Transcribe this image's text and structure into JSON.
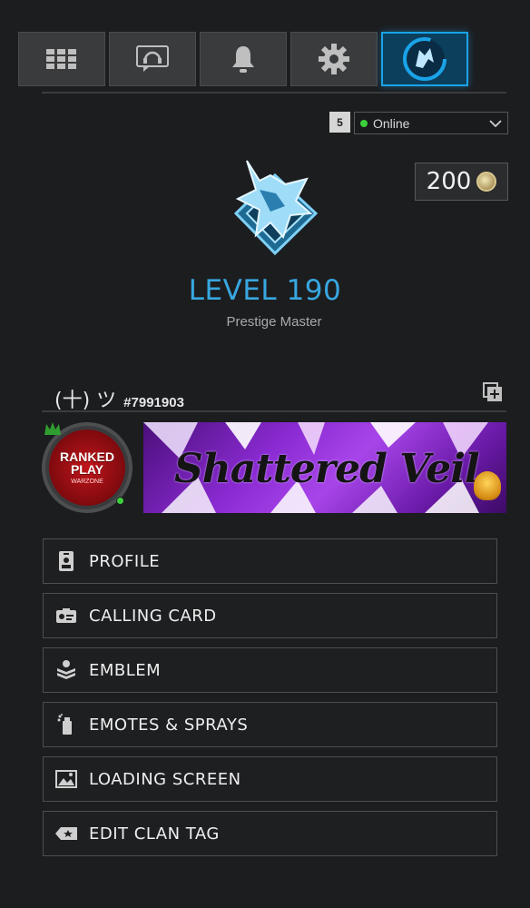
{
  "tabs": [
    {
      "icon": "grid-icon"
    },
    {
      "icon": "headset-icon"
    },
    {
      "icon": "bell-icon"
    },
    {
      "icon": "gear-icon"
    },
    {
      "icon": "wolf-profile-icon"
    }
  ],
  "status": {
    "party_count": "5",
    "selected": "Online",
    "dot_color": "#3ccf3c"
  },
  "currency": {
    "value": "200",
    "icon": "cod-points-coin-icon"
  },
  "rank": {
    "level": "LEVEL 190",
    "title": "Prestige Master",
    "accent": "#38a7e0"
  },
  "player": {
    "name": "(十) ツ",
    "id": "#7991903"
  },
  "emblem": {
    "line1": "RANKED",
    "line2": "PLAY",
    "line3": "WARZONE"
  },
  "calling_card": {
    "title": "Shattered Veil"
  },
  "menu": [
    {
      "label": "PROFILE",
      "icon": "id-badge-icon"
    },
    {
      "label": "CALLING CARD",
      "icon": "card-icon"
    },
    {
      "label": "EMBLEM",
      "icon": "emblem-icon"
    },
    {
      "label": "EMOTES & SPRAYS",
      "icon": "spray-can-icon"
    },
    {
      "label": "LOADING SCREEN",
      "icon": "image-icon"
    },
    {
      "label": "EDIT CLAN TAG",
      "icon": "tag-icon"
    }
  ]
}
